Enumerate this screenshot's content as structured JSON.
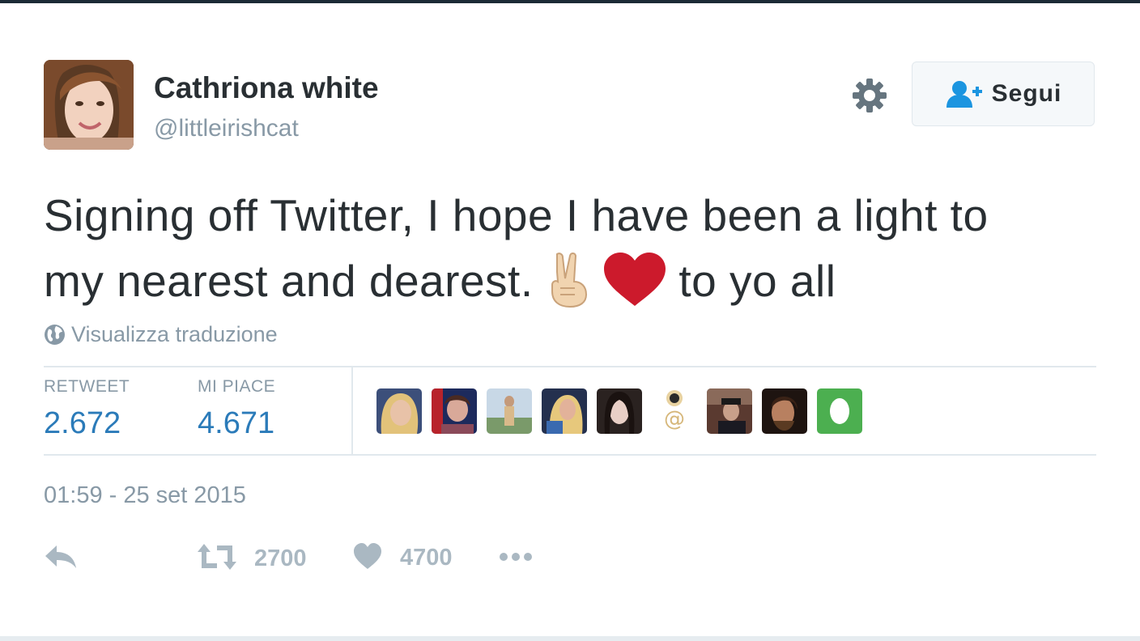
{
  "user": {
    "name": "Cathriona white",
    "handle": "@littleirishcat"
  },
  "follow_button": {
    "label": "Segui",
    "icon": "add-user-icon"
  },
  "settings_icon": "gear-icon",
  "tweet": {
    "text_line1": "Signing off Twitter, I hope I have been a light to",
    "text_line2_before": "my nearest and dearest.",
    "emoji_1": "victory-hand-emoji",
    "emoji_2": "red-heart-emoji",
    "text_line2_after": "to yo all"
  },
  "translate": {
    "label": "Visualizza traduzione",
    "icon": "globe-icon"
  },
  "stats": {
    "retweet_label": "RETWEET",
    "retweet_count": "2.672",
    "like_label": "MI PIACE",
    "like_count": "4.671"
  },
  "liker_avatars": [
    "avatar-1",
    "avatar-2",
    "avatar-3",
    "avatar-4",
    "avatar-5",
    "avatar-6",
    "avatar-7",
    "avatar-8",
    "avatar-9"
  ],
  "timestamp": "01:59 - 25 set 2015",
  "actions": {
    "reply_icon": "reply-icon",
    "retweet_icon": "retweet-icon",
    "retweet_count": "2700",
    "like_icon": "heart-icon",
    "like_count": "4700",
    "more_icon": "more-dots-icon"
  },
  "colors": {
    "link_blue": "#2b7bb9",
    "follow_icon_blue": "#1b95e0",
    "muted_gray": "#8899a6",
    "action_gray": "#aab8c2",
    "heart_red": "#cc1a2c",
    "top_bar": "#1c2b36"
  }
}
